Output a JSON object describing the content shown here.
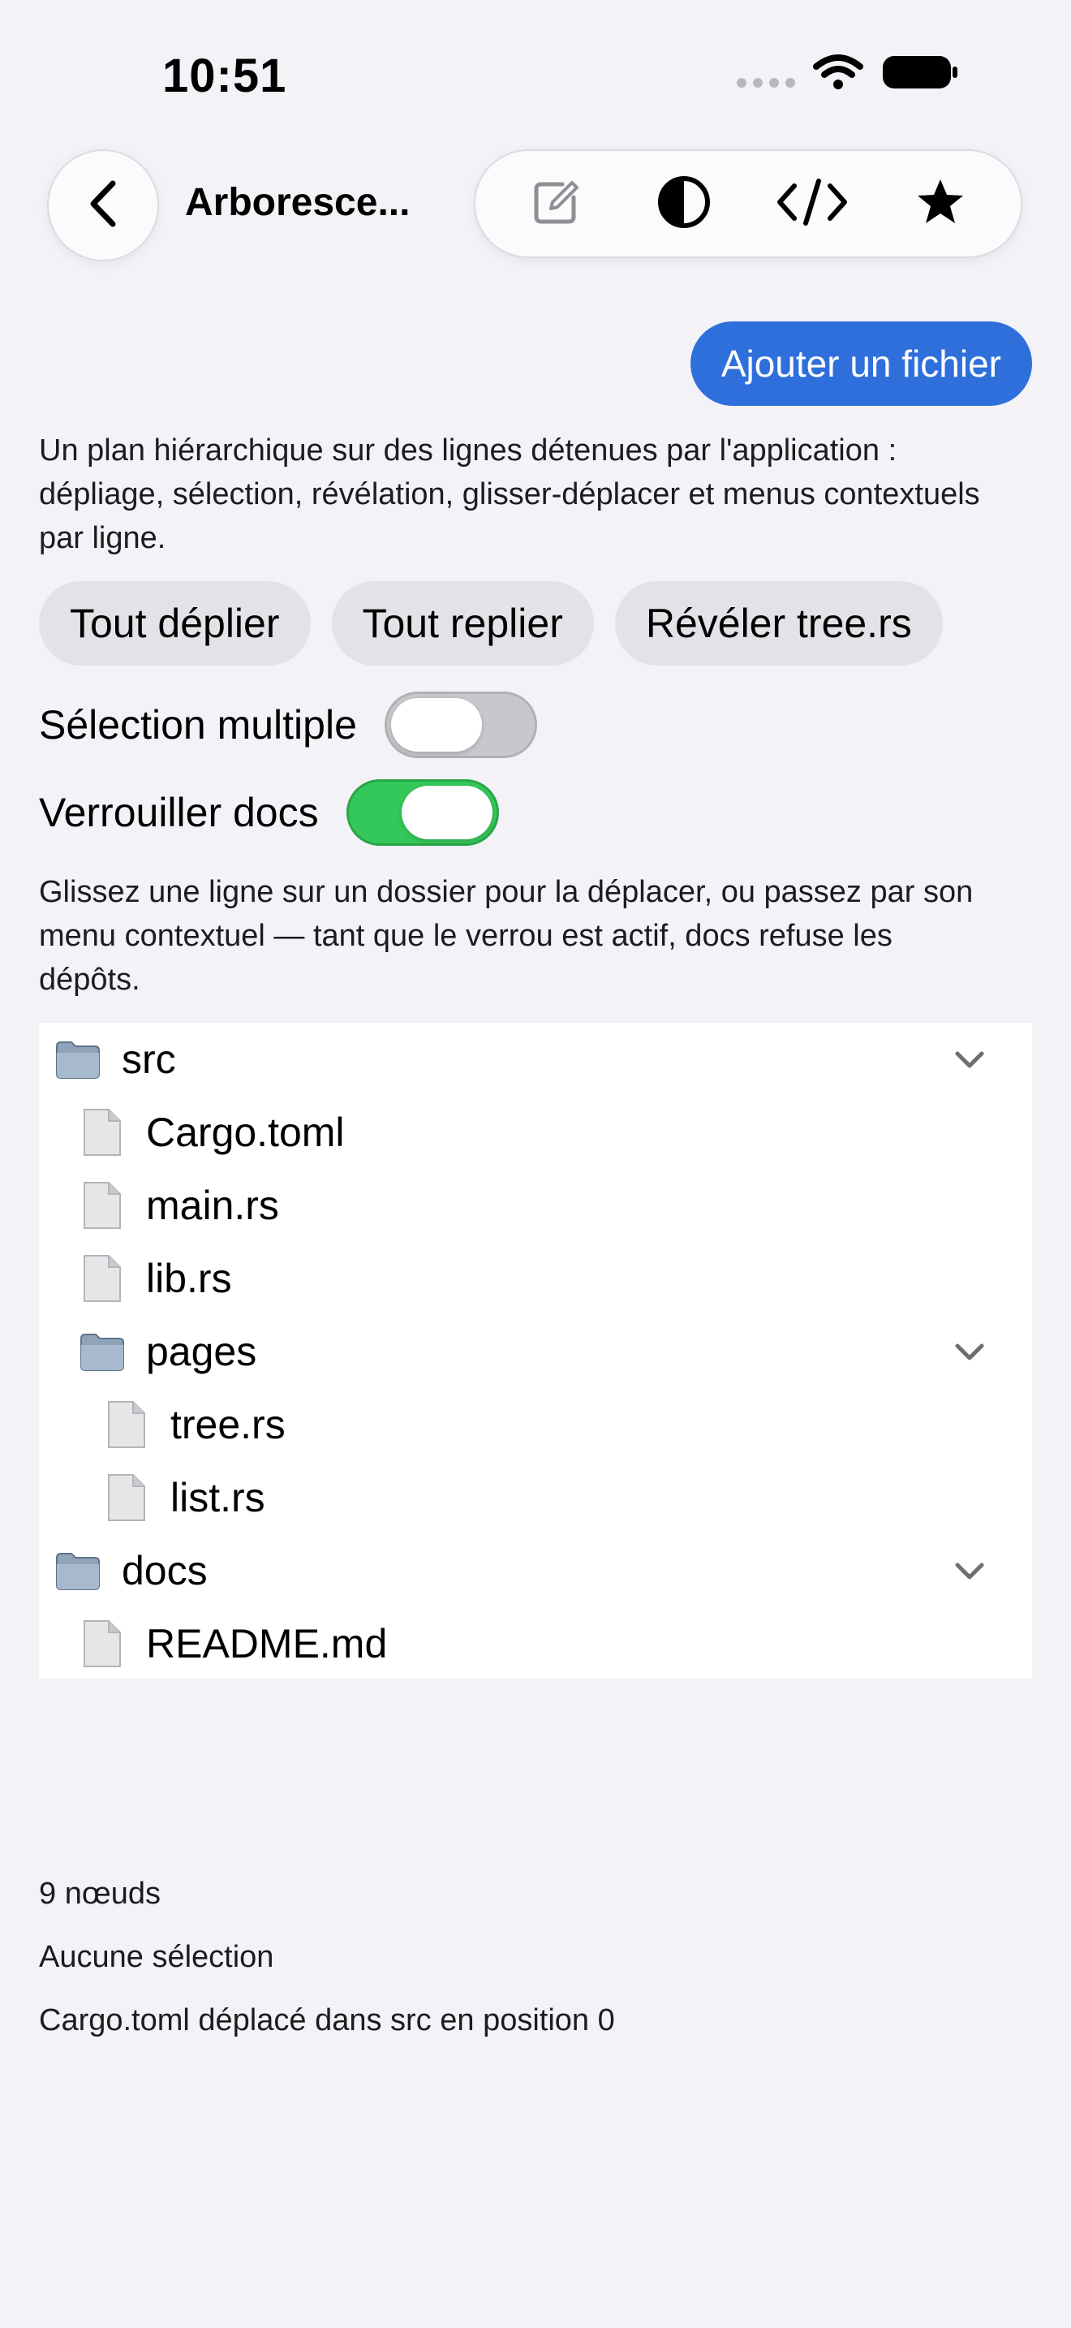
{
  "status": {
    "time": "10:51"
  },
  "nav": {
    "title": "Arboresce...",
    "back_icon": "chevron-left-icon",
    "tools": [
      "edit-icon",
      "contrast-icon",
      "code-icon",
      "star-icon"
    ]
  },
  "actions": {
    "add_file": "Ajouter un fichier"
  },
  "description": "Un plan hiérarchique sur des lignes détenues par l'application : dépliage, sélection, révélation, glisser-déplacer et menus contextuels par ligne.",
  "chips": [
    "Tout déplier",
    "Tout replier",
    "Révéler tree.rs"
  ],
  "toggles": {
    "multi_select": {
      "label": "Sélection multiple",
      "on": false
    },
    "lock_docs": {
      "label": "Verrouiller docs",
      "on": true
    }
  },
  "hint": "Glissez une ligne sur un dossier pour la déplacer, ou passez par son menu contextuel — tant que le verrou est actif, docs refuse les dépôts.",
  "tree": [
    {
      "label": "src",
      "type": "folder",
      "depth": 0,
      "expanded": true
    },
    {
      "label": "Cargo.toml",
      "type": "file",
      "depth": 1
    },
    {
      "label": "main.rs",
      "type": "file",
      "depth": 1
    },
    {
      "label": "lib.rs",
      "type": "file",
      "depth": 1
    },
    {
      "label": "pages",
      "type": "folder",
      "depth": 1,
      "expanded": true
    },
    {
      "label": "tree.rs",
      "type": "file",
      "depth": 2
    },
    {
      "label": "list.rs",
      "type": "file",
      "depth": 2
    },
    {
      "label": "docs",
      "type": "folder",
      "depth": 0,
      "expanded": true
    },
    {
      "label": "README.md",
      "type": "file",
      "depth": 1
    }
  ],
  "footer": {
    "node_count": "9 nœuds",
    "selection": "Aucune sélection",
    "last_move": "Cargo.toml déplacé dans src en position 0"
  },
  "colors": {
    "accent": "#2f6fdc",
    "toggle_on": "#34c759",
    "background": "#f2f2f7"
  }
}
